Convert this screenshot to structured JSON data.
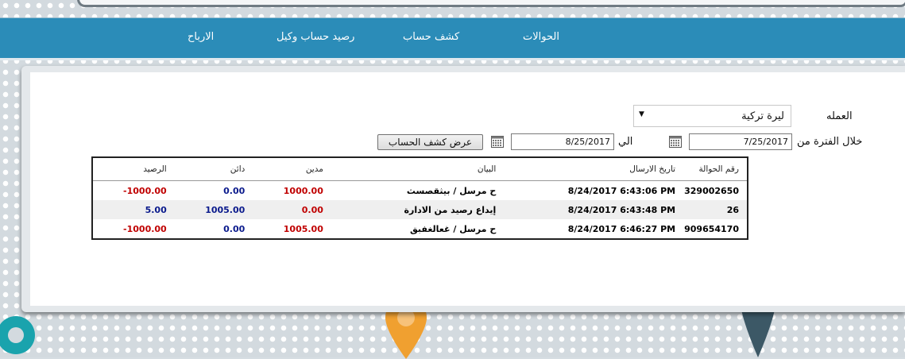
{
  "nav": {
    "items": [
      {
        "key": "transfers",
        "label": "الحوالات"
      },
      {
        "key": "statement",
        "label": "كشف حساب"
      },
      {
        "key": "agent_balance",
        "label": "رصيد حساب وكيل"
      },
      {
        "key": "profits",
        "label": "الارباح"
      }
    ]
  },
  "form": {
    "currency_label": "العمله",
    "currency_value": "ليرة تركية",
    "period_from_label": "خلال الفترة من",
    "date_from": "7/25/2017",
    "to_label": "الي",
    "date_to": "8/25/2017",
    "show_button": "عرض كشف الحساب"
  },
  "table": {
    "headers": {
      "number": "رقم الحوالة",
      "sent_date": "تاريخ الارسال",
      "description": "البيان",
      "debit": "مدين",
      "credit": "دائن",
      "balance": "الرصيد"
    },
    "rows": [
      {
        "number": "329002650",
        "sent_date": "8/24/2017 6:43:06 PM",
        "description": "ح مرسل / بيثقصسث",
        "debit": "1000.00",
        "credit": "0.00",
        "balance": "-1000.00"
      },
      {
        "number": "26",
        "sent_date": "8/24/2017 6:43:48 PM",
        "description": "إيداع رصيد من الادارة",
        "debit": "0.00",
        "credit": "1005.00",
        "balance": "5.00"
      },
      {
        "number": "909654170",
        "sent_date": "8/24/2017 6:46:27 PM",
        "description": "ح مرسل / غعالغفبق",
        "debit": "1005.00",
        "credit": "0.00",
        "balance": "-1000.00"
      }
    ]
  },
  "colors": {
    "navbar": "#2b8cb8",
    "debit": "#c00000",
    "credit": "#0a1a8c",
    "pin_orange": "#f0a030",
    "pin_dark": "#3c5866",
    "pin_teal": "#1aa3ad"
  },
  "icons": [
    "calendar-icon",
    "dropdown-arrow-icon",
    "map-pin-icon"
  ]
}
